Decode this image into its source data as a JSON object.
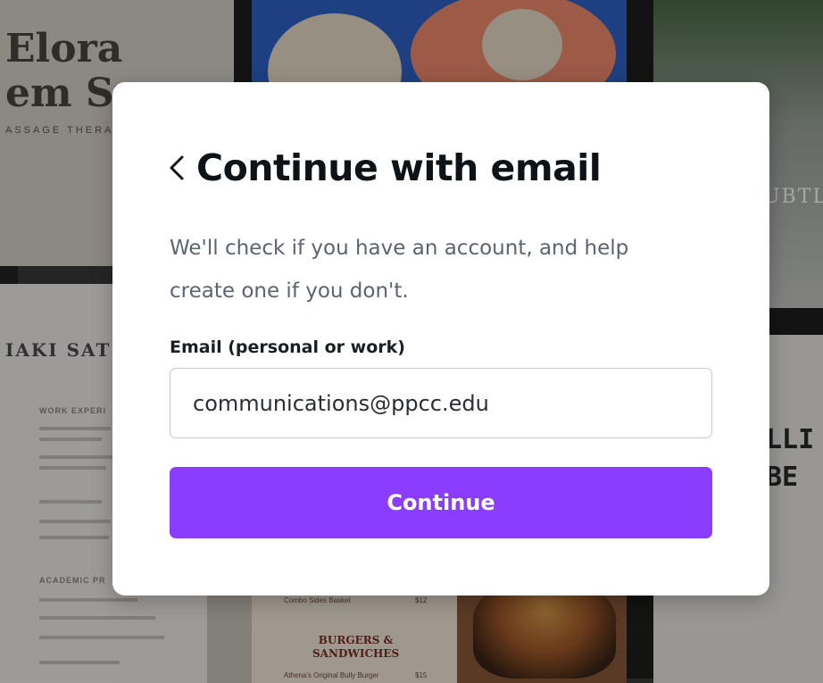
{
  "background": {
    "tile_texts": {
      "elora_line1": "Elora",
      "elora_line2": "em Sp",
      "massage": "ASSAGE THERAPY",
      "resume_name": "IAKI SAT",
      "resume_section1": "WORK EXPERI",
      "resume_section2": "ACADEMIC PR",
      "menu_item_top": "Combo Sides Basket",
      "menu_price_top": "$12",
      "menu_heading_line1": "BURGERS &",
      "menu_heading_line2": "SANDWICHES",
      "menu_item": "Athena's Original Bully Burger",
      "menu_price": "$15",
      "subtle": "UBTL",
      "lli_line1": "LLI",
      "lli_line2": "BE"
    }
  },
  "modal": {
    "back_icon": "chevron-left-icon",
    "title": "Continue with email",
    "subtitle_line1": "We'll check if you have an account, and help",
    "subtitle_line2": "create one if you don't.",
    "email_label": "Email (personal or work)",
    "email_value": "communications@ppcc.edu",
    "continue_label": "Continue",
    "accent_color": "#8b3dff"
  }
}
